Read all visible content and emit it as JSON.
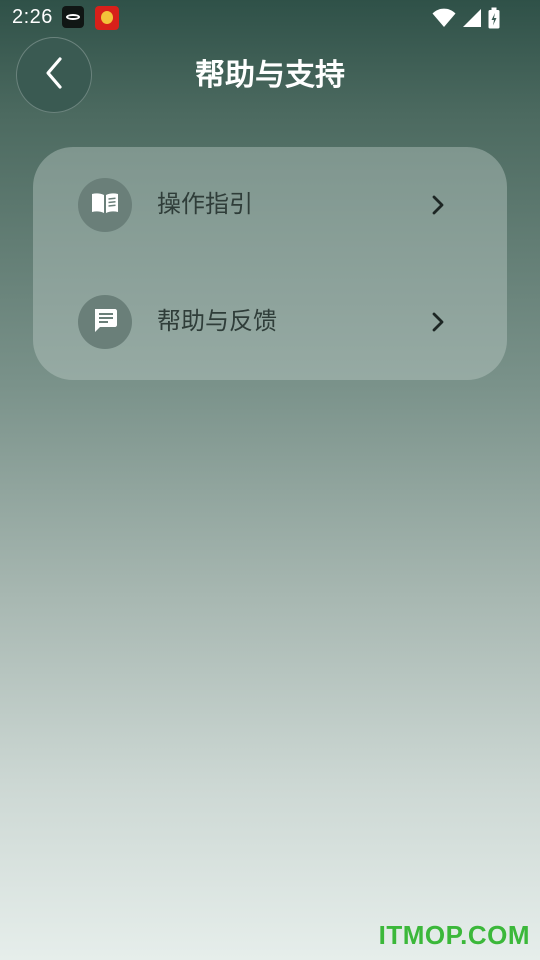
{
  "status_bar": {
    "time": "2:26",
    "notification_icons": [
      "app-notification-icon",
      "red-envelope-icon"
    ],
    "system_icons": [
      "wifi-icon",
      "cell-signal-icon",
      "battery-icon"
    ]
  },
  "header": {
    "back_icon": "chevron-left-icon",
    "title": "帮助与支持"
  },
  "menu": {
    "items": [
      {
        "icon": "book-icon",
        "label": "操作指引",
        "chevron": "chevron-right-icon"
      },
      {
        "icon": "message-icon",
        "label": "帮助与反馈",
        "chevron": "chevron-right-icon"
      }
    ]
  },
  "watermark": "ITMOP.COM",
  "colors": {
    "background_top": "#2f5148",
    "background_bottom": "#e6eeeb",
    "card": "#a9bab5",
    "icon_circle": "#6a7f79",
    "label_text": "#2f3d39",
    "watermark": "#3bb83a"
  }
}
